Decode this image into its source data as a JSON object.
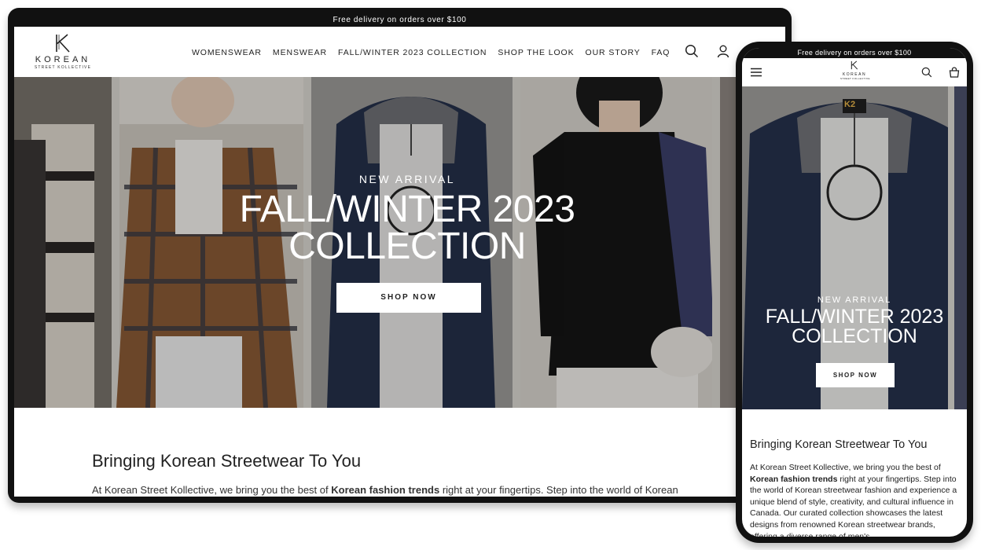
{
  "announcement": "Free delivery on orders over $100",
  "brand": {
    "name": "KOREAN",
    "tagline": "STREET KOLLECTIVE",
    "mark": "K"
  },
  "nav": [
    "WOMENSWEAR",
    "MENSWEAR",
    "FALL/WINTER 2023 COLLECTION",
    "SHOP THE LOOK",
    "OUR STORY",
    "FAQ"
  ],
  "icons": {
    "search": "search-icon",
    "account": "account-icon",
    "menu": "menu-icon",
    "bag": "bag-icon"
  },
  "hero": {
    "kicker": "NEW ARRIVAL",
    "title_line1": "FALL/WINTER 2023",
    "title_line2": "COLLECTION",
    "cta": "SHOP NOW",
    "hanger_tag": "K2"
  },
  "about": {
    "heading": "Bringing Korean Streetwear To You",
    "desktop_p_before": "At Korean Street Kollective, we bring you the best of ",
    "p_bold": "Korean fashion trends",
    "desktop_p_after": " right at your fingertips. Step into the world of Korean",
    "mobile_p_before": "At Korean Street Kollective, we bring you the best of ",
    "mobile_p_after": " right at your fingertips. Step into the world of Korean streetwear fashion and experience a unique blend of style, creativity, and cultural influence in Canada. Our curated collection showcases the latest designs from renowned Korean streetwear brands, offering a diverse range of men's"
  },
  "colors": {
    "frame": "#111111",
    "text": "#222222",
    "button_bg": "#ffffff"
  }
}
